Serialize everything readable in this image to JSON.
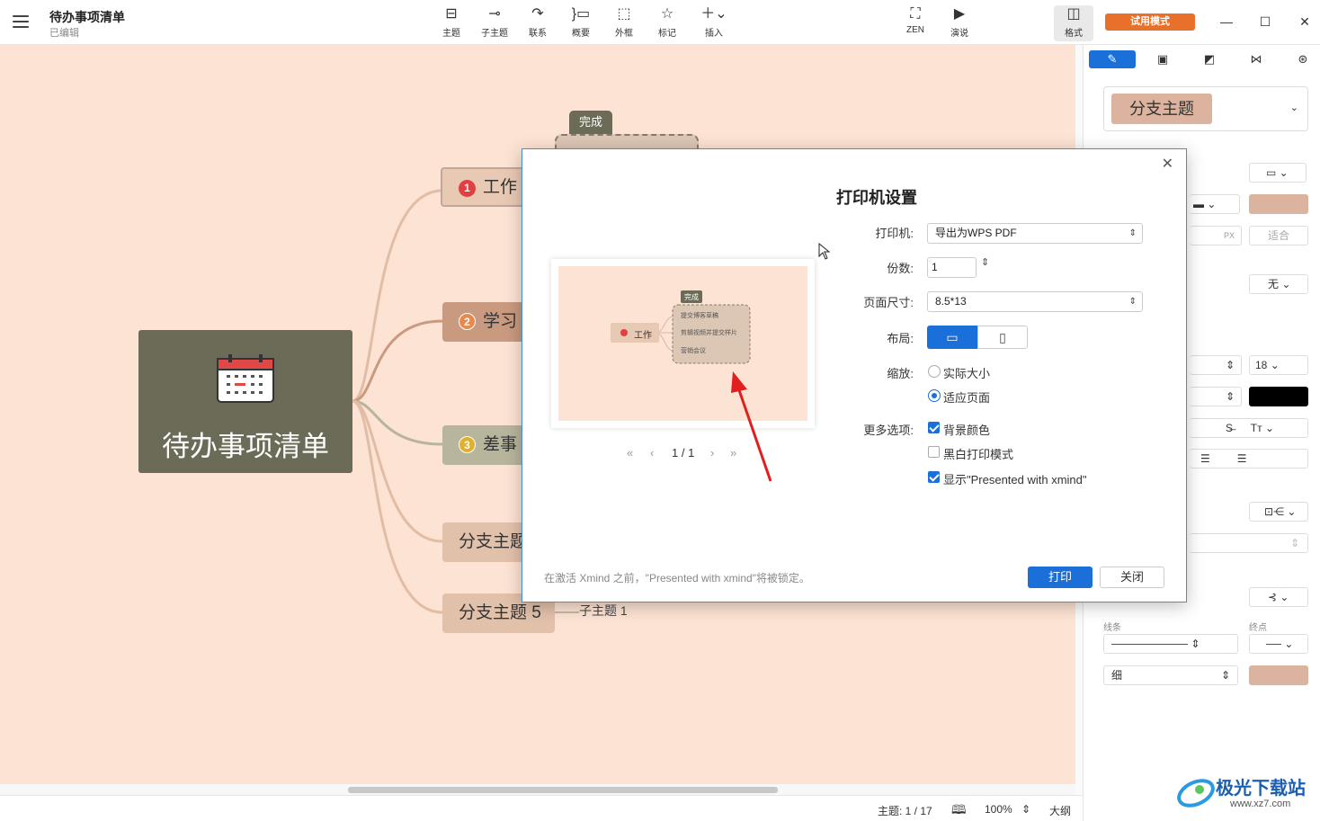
{
  "topbar": {
    "title": "待办事项清单",
    "status": "已编辑",
    "tools": [
      {
        "label": "主题",
        "icon": "topic-icon"
      },
      {
        "label": "子主题",
        "icon": "subtopic-icon"
      },
      {
        "label": "联系",
        "icon": "relationship-icon"
      },
      {
        "label": "概要",
        "icon": "summary-icon"
      },
      {
        "label": "外框",
        "icon": "boundary-icon"
      },
      {
        "label": "标记",
        "icon": "star-icon"
      },
      {
        "label": "插入",
        "icon": "plus-icon"
      }
    ],
    "zen_label": "ZEN",
    "present_label": "演说",
    "format_label": "格式",
    "trial_label": "试用模式"
  },
  "map": {
    "central": "待办事项清单",
    "callout": "完成",
    "branches": [
      {
        "num": "1",
        "label": "工作",
        "color": "#e04040"
      },
      {
        "num": "2",
        "label": "学习",
        "color": "#e88a50"
      },
      {
        "num": "3",
        "label": "差事",
        "color": "#e0b030"
      },
      {
        "label": "分支主题"
      },
      {
        "label": "分支主题 5"
      }
    ],
    "subtopic": "子主题 1"
  },
  "statusbar": {
    "topic_count": "主题: 1 / 17",
    "zoom": "100%",
    "outline": "大纲"
  },
  "panel": {
    "tabs": [
      "style-icon",
      "slide-icon",
      "sticker-icon",
      "map-icon",
      "theme-icon"
    ],
    "style_name": "分支主题",
    "shape_value": "▭",
    "px_unit": "PX",
    "fit_label": "适合",
    "none_label": "无",
    "font_size": "18",
    "line_width_label": "线条",
    "end_label": "终点",
    "thin_label": "细",
    "colors": {
      "fill": "#dbb39e",
      "text": "#000000",
      "line": "#dbb39e"
    }
  },
  "dialog": {
    "title": "打印机设置",
    "printer_label": "打印机:",
    "printer_value": "导出为WPS PDF",
    "copies_label": "份数:",
    "copies_value": "1",
    "pagesize_label": "页面尺寸:",
    "pagesize_value": "8.5*13",
    "layout_label": "布局:",
    "scale_label": "缩放:",
    "scale_actual": "实际大小",
    "scale_fit": "适应页面",
    "more_label": "更多选项:",
    "opt_bg": "背景颜色",
    "opt_bw": "黑白打印模式",
    "opt_presented": "显示\"Presented with xmind\"",
    "pager": "1 / 1",
    "preview": {
      "callout": "完成",
      "topic": "工作",
      "items": [
        "提交博客草稿",
        "剪辑视频并提交样片",
        "营销会议"
      ]
    },
    "note": "在激活 Xmind 之前，\"Presented with xmind\"将被锁定。",
    "print_label": "打印",
    "close_label": "关闭"
  },
  "watermark": {
    "brand": "极光下载站",
    "url": "www.xz7.com"
  }
}
